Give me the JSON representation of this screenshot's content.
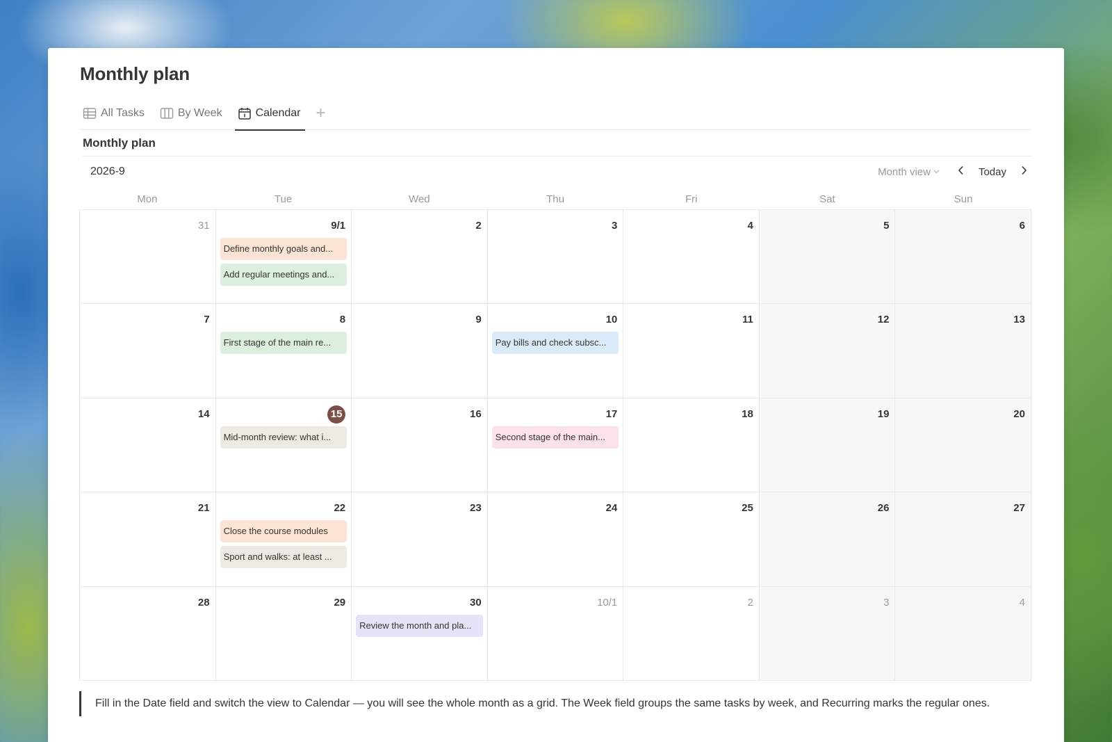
{
  "page": {
    "title": "Monthly plan"
  },
  "tabs": [
    {
      "label": "All Tasks",
      "icon": "table-icon",
      "active": false
    },
    {
      "label": "By Week",
      "icon": "board-icon",
      "active": false
    },
    {
      "label": "Calendar",
      "icon": "calendar-icon",
      "active": true
    }
  ],
  "add_tab_label": "+",
  "database": {
    "title": "Monthly plan"
  },
  "calendar": {
    "month_label": "2026-9",
    "view_label": "Month view",
    "today_label": "Today",
    "weekdays": [
      "Mon",
      "Tue",
      "Wed",
      "Thu",
      "Fri",
      "Sat",
      "Sun"
    ],
    "today_day": "15",
    "weeks": [
      [
        {
          "day": "31",
          "muted": true,
          "events": []
        },
        {
          "day": "9/1",
          "events": [
            {
              "title": "Define monthly goals and...",
              "color": "orange"
            },
            {
              "title": "Add regular meetings and...",
              "color": "green"
            }
          ]
        },
        {
          "day": "2",
          "events": []
        },
        {
          "day": "3",
          "events": []
        },
        {
          "day": "4",
          "events": []
        },
        {
          "day": "5",
          "weekend": true,
          "events": []
        },
        {
          "day": "6",
          "weekend": true,
          "events": []
        }
      ],
      [
        {
          "day": "7",
          "events": []
        },
        {
          "day": "8",
          "events": [
            {
              "title": "First stage of the main re...",
              "color": "green"
            }
          ]
        },
        {
          "day": "9",
          "events": []
        },
        {
          "day": "10",
          "events": [
            {
              "title": "Pay bills and check subsc...",
              "color": "blue"
            }
          ]
        },
        {
          "day": "11",
          "events": []
        },
        {
          "day": "12",
          "weekend": true,
          "events": []
        },
        {
          "day": "13",
          "weekend": true,
          "events": []
        }
      ],
      [
        {
          "day": "14",
          "events": []
        },
        {
          "day": "15",
          "today": true,
          "events": [
            {
              "title": "Mid-month review: what i...",
              "color": "brown"
            }
          ]
        },
        {
          "day": "16",
          "events": []
        },
        {
          "day": "17",
          "events": [
            {
              "title": "Second stage of the main...",
              "color": "pink"
            }
          ]
        },
        {
          "day": "18",
          "events": []
        },
        {
          "day": "19",
          "weekend": true,
          "events": []
        },
        {
          "day": "20",
          "weekend": true,
          "events": []
        }
      ],
      [
        {
          "day": "21",
          "events": []
        },
        {
          "day": "22",
          "events": [
            {
              "title": "Close the course modules",
              "color": "orange"
            },
            {
              "title": "Sport and walks: at least ...",
              "color": "brown"
            }
          ]
        },
        {
          "day": "23",
          "events": []
        },
        {
          "day": "24",
          "events": []
        },
        {
          "day": "25",
          "events": []
        },
        {
          "day": "26",
          "weekend": true,
          "events": []
        },
        {
          "day": "27",
          "weekend": true,
          "events": []
        }
      ],
      [
        {
          "day": "28",
          "events": []
        },
        {
          "day": "29",
          "events": []
        },
        {
          "day": "30",
          "events": [
            {
              "title": "Review the month and pla...",
              "color": "purple"
            }
          ]
        },
        {
          "day": "10/1",
          "muted": true,
          "events": []
        },
        {
          "day": "2",
          "muted": true,
          "events": []
        },
        {
          "day": "3",
          "muted": true,
          "weekend": true,
          "events": []
        },
        {
          "day": "4",
          "muted": true,
          "weekend": true,
          "events": []
        }
      ]
    ]
  },
  "callout": {
    "text": "Fill in the Date field and switch the view to Calendar — you will see the whole month as a grid. The Week field groups the same tasks by week, and Recurring marks the regular ones."
  },
  "colors": {
    "orange": "#fbe4d3",
    "green": "#dcefdf",
    "blue": "#dbeaf8",
    "brown": "#ede9e3",
    "pink": "#fbe1e8",
    "purple": "#e6e2f8",
    "today_badge": "#7a4f45"
  }
}
